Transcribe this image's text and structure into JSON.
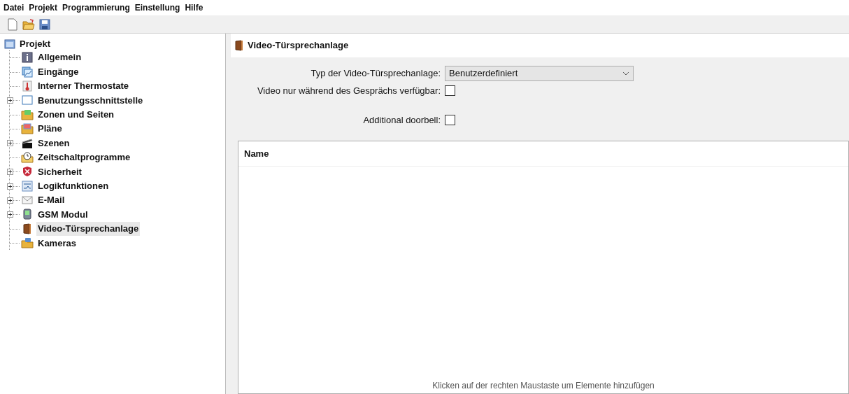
{
  "menu": [
    "Datei",
    "Projekt",
    "Programmierung",
    "Einstellung",
    "Hilfe"
  ],
  "tree": {
    "label": "Projekt",
    "expanded": true,
    "children": [
      {
        "label": "Allgemein",
        "expandable": false,
        "selected": false
      },
      {
        "label": "Eingänge",
        "expandable": false,
        "selected": false
      },
      {
        "label": "Interner Thermostate",
        "expandable": false,
        "selected": false
      },
      {
        "label": "Benutzungsschnittstelle",
        "expandable": true,
        "selected": false
      },
      {
        "label": "Zonen und Seiten",
        "expandable": false,
        "selected": false
      },
      {
        "label": "Pläne",
        "expandable": false,
        "selected": false
      },
      {
        "label": "Szenen",
        "expandable": true,
        "selected": false
      },
      {
        "label": "Zeitschaltprogramme",
        "expandable": false,
        "selected": false
      },
      {
        "label": "Sicherheit",
        "expandable": true,
        "selected": false
      },
      {
        "label": "Logikfunktionen",
        "expandable": true,
        "selected": false
      },
      {
        "label": "E-Mail",
        "expandable": true,
        "selected": false
      },
      {
        "label": "GSM Modul",
        "expandable": true,
        "selected": false
      },
      {
        "label": "Video-Türsprechanlage",
        "expandable": false,
        "selected": true
      },
      {
        "label": "Kameras",
        "expandable": false,
        "selected": false
      }
    ]
  },
  "panel": {
    "title": "Video-Türsprechanlage",
    "fields": [
      {
        "kind": "dropdown",
        "label": "Typ der Video-Türsprechanlage:",
        "value": "Benutzerdefiniert"
      },
      {
        "kind": "checkbox",
        "label": "Video nur während des Gesprächs verfügbar:",
        "checked": false
      },
      {
        "kind": "checkbox",
        "label": "Additional doorbell:",
        "checked": false
      }
    ],
    "table": {
      "columns": [
        "Name"
      ],
      "empty_text": "Klicken auf der rechten Maustaste um Elemente hinzufügen"
    }
  }
}
